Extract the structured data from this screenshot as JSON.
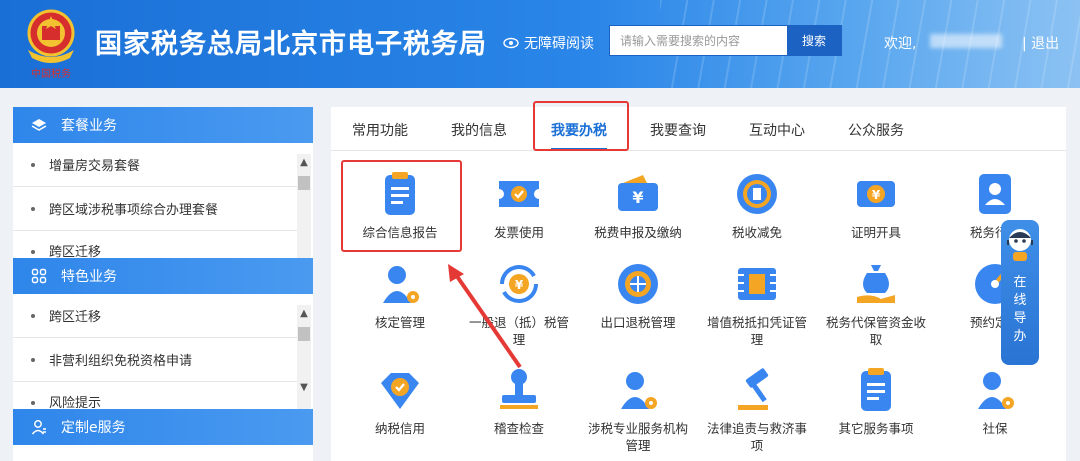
{
  "header": {
    "emblem_text": "中国税务",
    "site_title": "国家税务总局北京市电子税务局",
    "accessibility_label": "无障碍阅读",
    "search_placeholder": "请输入需要搜索的内容",
    "search_button": "搜索",
    "welcome_label": "欢迎,",
    "logout_label": "| 退出"
  },
  "sidebar": {
    "sections": [
      {
        "title": "套餐业务",
        "icon": "layers-icon",
        "items": [
          "增量房交易套餐",
          "跨区域涉税事项综合办理套餐",
          "跨区迁移"
        ]
      },
      {
        "title": "特色业务",
        "icon": "grid-icon",
        "items": [
          "跨区迁移",
          "非营利组织免税资格申请",
          "风险提示"
        ]
      },
      {
        "title": "定制e服务",
        "icon": "user-icon",
        "items": []
      }
    ]
  },
  "tabs": [
    "常用功能",
    "我的信息",
    "我要办税",
    "我要查询",
    "互动中心",
    "公众服务"
  ],
  "active_tab": "我要办税",
  "tiles": [
    {
      "label": "综合信息报告",
      "icon": "clipboard-report-icon"
    },
    {
      "label": "发票使用",
      "icon": "invoice-ticket-icon"
    },
    {
      "label": "税费申报及缴纳",
      "icon": "wallet-yuan-icon"
    },
    {
      "label": "税收减免",
      "icon": "tax-reduction-coin-icon"
    },
    {
      "label": "证明开具",
      "icon": "certificate-yuan-icon"
    },
    {
      "label": "税务行政",
      "icon": "admin-person-icon"
    },
    {
      "label": "核定管理",
      "icon": "person-gear-icon"
    },
    {
      "label": "一般退（抵）税管理",
      "icon": "refund-cycle-icon"
    },
    {
      "label": "出口退税管理",
      "icon": "globe-export-icon"
    },
    {
      "label": "增值税抵扣凭证管理",
      "icon": "vat-voucher-icon"
    },
    {
      "label": "税务代保管资金收取",
      "icon": "money-bag-hand-icon"
    },
    {
      "label": "预约定价",
      "icon": "gauge-icon"
    },
    {
      "label": "纳税信用",
      "icon": "credit-diamond-icon"
    },
    {
      "label": "稽查检查",
      "icon": "stamp-inspection-icon"
    },
    {
      "label": "涉税专业服务机构管理",
      "icon": "agency-person-gear-icon"
    },
    {
      "label": "法律追责与救济事项",
      "icon": "gavel-icon"
    },
    {
      "label": "其它服务事项",
      "icon": "list-document-icon"
    },
    {
      "label": "社保",
      "icon": "social-security-person-icon"
    }
  ],
  "float_guide": {
    "label": "在线导办"
  },
  "colors": {
    "brand_blue": "#1a6fd6",
    "highlight_red": "#e53935",
    "icon_blue": "#3a86f0",
    "icon_orange": "#f5a524"
  }
}
